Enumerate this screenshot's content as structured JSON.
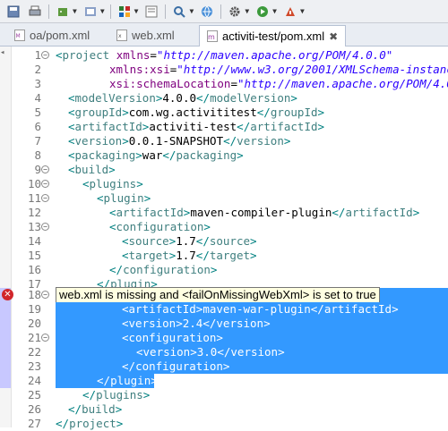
{
  "toolbar": {
    "icons": [
      "save-icon",
      "print-icon",
      "debug-icon",
      "run-icon",
      "new-server-icon",
      "palette-icon",
      "open-type-icon",
      "search-icon",
      "globe-icon",
      "gear-icon",
      "play-icon",
      "external-tools-icon"
    ]
  },
  "tabs": [
    {
      "label": "oa/pom.xml",
      "active": false
    },
    {
      "label": "web.xml",
      "active": false
    },
    {
      "label": "activiti-test/pom.xml",
      "active": true,
      "close": "✖"
    }
  ],
  "tooltip": "web.xml is missing and <failOnMissingWebXml> is set to true",
  "lines": [
    {
      "n": "1",
      "fold": "⊖"
    },
    {
      "n": "2"
    },
    {
      "n": "3"
    },
    {
      "n": "4"
    },
    {
      "n": "5"
    },
    {
      "n": "6"
    },
    {
      "n": "7"
    },
    {
      "n": "8"
    },
    {
      "n": "9",
      "fold": "⊖"
    },
    {
      "n": "10",
      "fold": "⊖"
    },
    {
      "n": "11",
      "fold": "⊖"
    },
    {
      "n": "12"
    },
    {
      "n": "13",
      "fold": "⊖"
    },
    {
      "n": "14"
    },
    {
      "n": "15"
    },
    {
      "n": "16"
    },
    {
      "n": "17"
    },
    {
      "n": "18",
      "fold": "⊖"
    },
    {
      "n": "19"
    },
    {
      "n": "20"
    },
    {
      "n": "21",
      "fold": "⊖"
    },
    {
      "n": "22"
    },
    {
      "n": "23"
    },
    {
      "n": "24"
    },
    {
      "n": "25"
    },
    {
      "n": "26"
    },
    {
      "n": "27"
    }
  ],
  "code": {
    "l1": {
      "tag": "project",
      "attr": "xmlns",
      "val": "\"http://maven.apache.org/POM/4.0.0\""
    },
    "l2": {
      "attr": "xmlns:xsi",
      "val": "\"http://www.w3.org/2001/XMLSchema-instanc"
    },
    "l3": {
      "attr": "xsi:schemaLocation",
      "val": "\"http://maven.apache.org/POM/4.0"
    },
    "l4": {
      "tag": "modelVersion",
      "text": "4.0.0"
    },
    "l5": {
      "tag": "groupId",
      "text": "com.wg.activititest"
    },
    "l6": {
      "tag": "artifactId",
      "text": "activiti-test"
    },
    "l7": {
      "tag": "version",
      "text": "0.0.1-SNAPSHOT"
    },
    "l8": {
      "tag": "packaging",
      "text": "war"
    },
    "l9": {
      "tag": "build"
    },
    "l10": {
      "tag": "plugins"
    },
    "l11": {
      "tag": "plugin"
    },
    "l12": {
      "tag": "artifactId",
      "text": "maven-compiler-plugin"
    },
    "l13": {
      "tag": "configuration"
    },
    "l14": {
      "tag": "source",
      "text": "1.7"
    },
    "l15": {
      "tag": "target",
      "text": "1.7"
    },
    "l16": {
      "tag": "configuration"
    },
    "l17": {
      "tag": "plugin"
    },
    "l19": {
      "tag": "artifactId",
      "text": "maven-war-plugin"
    },
    "l20": {
      "tag": "version",
      "text": "2.4"
    },
    "l21": {
      "tag": "configuration"
    },
    "l22": {
      "tag": "version",
      "text": "3.0"
    },
    "l23": {
      "tag": "configuration"
    },
    "l24": {
      "tag": "plugin"
    },
    "l25": {
      "tag": "plugins"
    },
    "l26": {
      "tag": "build"
    },
    "l27": {
      "tag": "project"
    }
  },
  "colors": {
    "selection": "#3399ff",
    "tag": "#3f7f7f",
    "attribute": "#7f007f",
    "value": "#2a00ff",
    "error": "#d1262b"
  }
}
